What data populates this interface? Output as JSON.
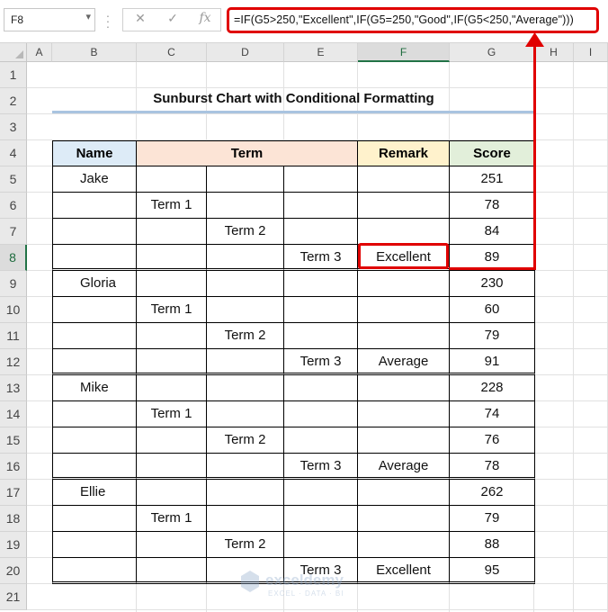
{
  "formula_bar": {
    "name_box": "F8",
    "cancel_icon": "✕",
    "enter_icon": "✓",
    "fx_label": "fx",
    "formula": "=IF(G5>250,\"Excellent\",IF(G5=250,\"Good\",IF(G5<250,\"Average\")))"
  },
  "columns": [
    "A",
    "B",
    "C",
    "D",
    "E",
    "F",
    "G",
    "H",
    "I"
  ],
  "rows": [
    "1",
    "2",
    "3",
    "4",
    "5",
    "6",
    "7",
    "8",
    "9",
    "10",
    "11",
    "12",
    "13",
    "14",
    "15",
    "16",
    "17",
    "18",
    "19",
    "20",
    "21"
  ],
  "selected_cell": "F8",
  "sheet": {
    "title": "Sunburst Chart with Conditional Formatting",
    "headers": {
      "name": "Name",
      "term": "Term",
      "remark": "Remark",
      "score": "Score"
    },
    "header_colors": {
      "name": "#ddebf7",
      "term": "#fce4d6",
      "remark": "#fff2cc",
      "score": "#e2efda"
    },
    "table_rows": [
      {
        "name": "Jake",
        "c": "",
        "d": "",
        "e": "",
        "remark": "",
        "score": "251"
      },
      {
        "name": "",
        "c": "Term 1",
        "d": "",
        "e": "",
        "remark": "",
        "score": "78"
      },
      {
        "name": "",
        "c": "",
        "d": "Term 2",
        "e": "",
        "remark": "",
        "score": "84"
      },
      {
        "name": "",
        "c": "",
        "d": "",
        "e": "Term 3",
        "remark": "Excellent",
        "score": "89"
      },
      {
        "name": "Gloria",
        "c": "",
        "d": "",
        "e": "",
        "remark": "",
        "score": "230"
      },
      {
        "name": "",
        "c": "Term 1",
        "d": "",
        "e": "",
        "remark": "",
        "score": "60"
      },
      {
        "name": "",
        "c": "",
        "d": "Term 2",
        "e": "",
        "remark": "",
        "score": "79"
      },
      {
        "name": "",
        "c": "",
        "d": "",
        "e": "Term 3",
        "remark": "Average",
        "score": "91"
      },
      {
        "name": "Mike",
        "c": "",
        "d": "",
        "e": "",
        "remark": "",
        "score": "228"
      },
      {
        "name": "",
        "c": "Term 1",
        "d": "",
        "e": "",
        "remark": "",
        "score": "74"
      },
      {
        "name": "",
        "c": "",
        "d": "Term 2",
        "e": "",
        "remark": "",
        "score": "76"
      },
      {
        "name": "",
        "c": "",
        "d": "",
        "e": "Term 3",
        "remark": "Average",
        "score": "78"
      },
      {
        "name": "Ellie",
        "c": "",
        "d": "",
        "e": "",
        "remark": "",
        "score": "262"
      },
      {
        "name": "",
        "c": "Term 1",
        "d": "",
        "e": "",
        "remark": "",
        "score": "79"
      },
      {
        "name": "",
        "c": "",
        "d": "Term 2",
        "e": "",
        "remark": "",
        "score": "88"
      },
      {
        "name": "",
        "c": "",
        "d": "",
        "e": "Term 3",
        "remark": "Excellent",
        "score": "95"
      }
    ]
  },
  "watermark": {
    "brand": "exceldemy",
    "tagline": "EXCEL · DATA · BI"
  },
  "colors": {
    "accent_red": "#e00000",
    "excel_green": "#217346"
  }
}
